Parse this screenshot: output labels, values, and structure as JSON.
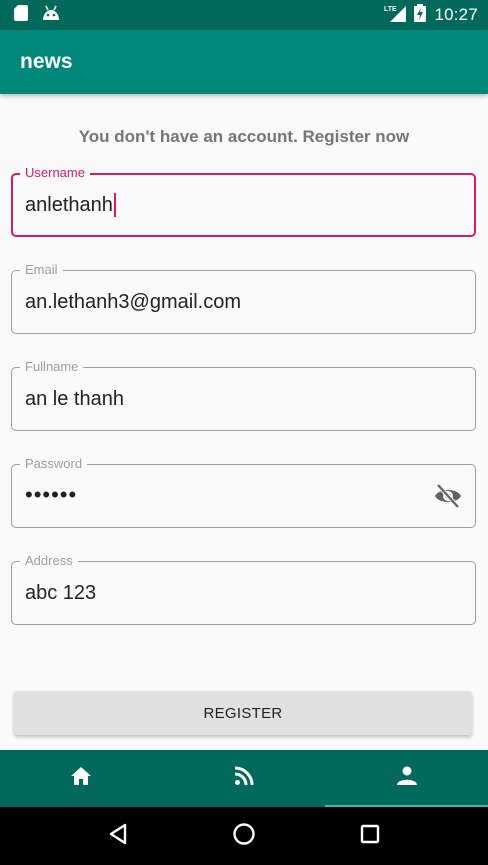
{
  "app": {
    "title": "news"
  },
  "status_bar": {
    "time": "10:27",
    "network": "LTE"
  },
  "heading": "You don't have an account. Register now",
  "fields": {
    "username": {
      "label": "Username",
      "value": "anlethanh"
    },
    "email": {
      "label": "Email",
      "value": "an.lethanh3@gmail.com"
    },
    "fullname": {
      "label": "Fullname",
      "value": "an le thanh"
    },
    "password": {
      "label": "Password",
      "value": "••••••"
    },
    "address": {
      "label": "Address",
      "value": "abc 123"
    }
  },
  "register_button": "REGISTER",
  "bottom_nav": {
    "items": [
      {
        "icon": "home-icon"
      },
      {
        "icon": "rss-feed-icon"
      },
      {
        "icon": "person-icon",
        "active": true
      }
    ]
  },
  "colors": {
    "status_bar": "#00695c",
    "app_bar": "#00897b",
    "accent": "#d81b60",
    "bottom_nav": "#00695c"
  }
}
